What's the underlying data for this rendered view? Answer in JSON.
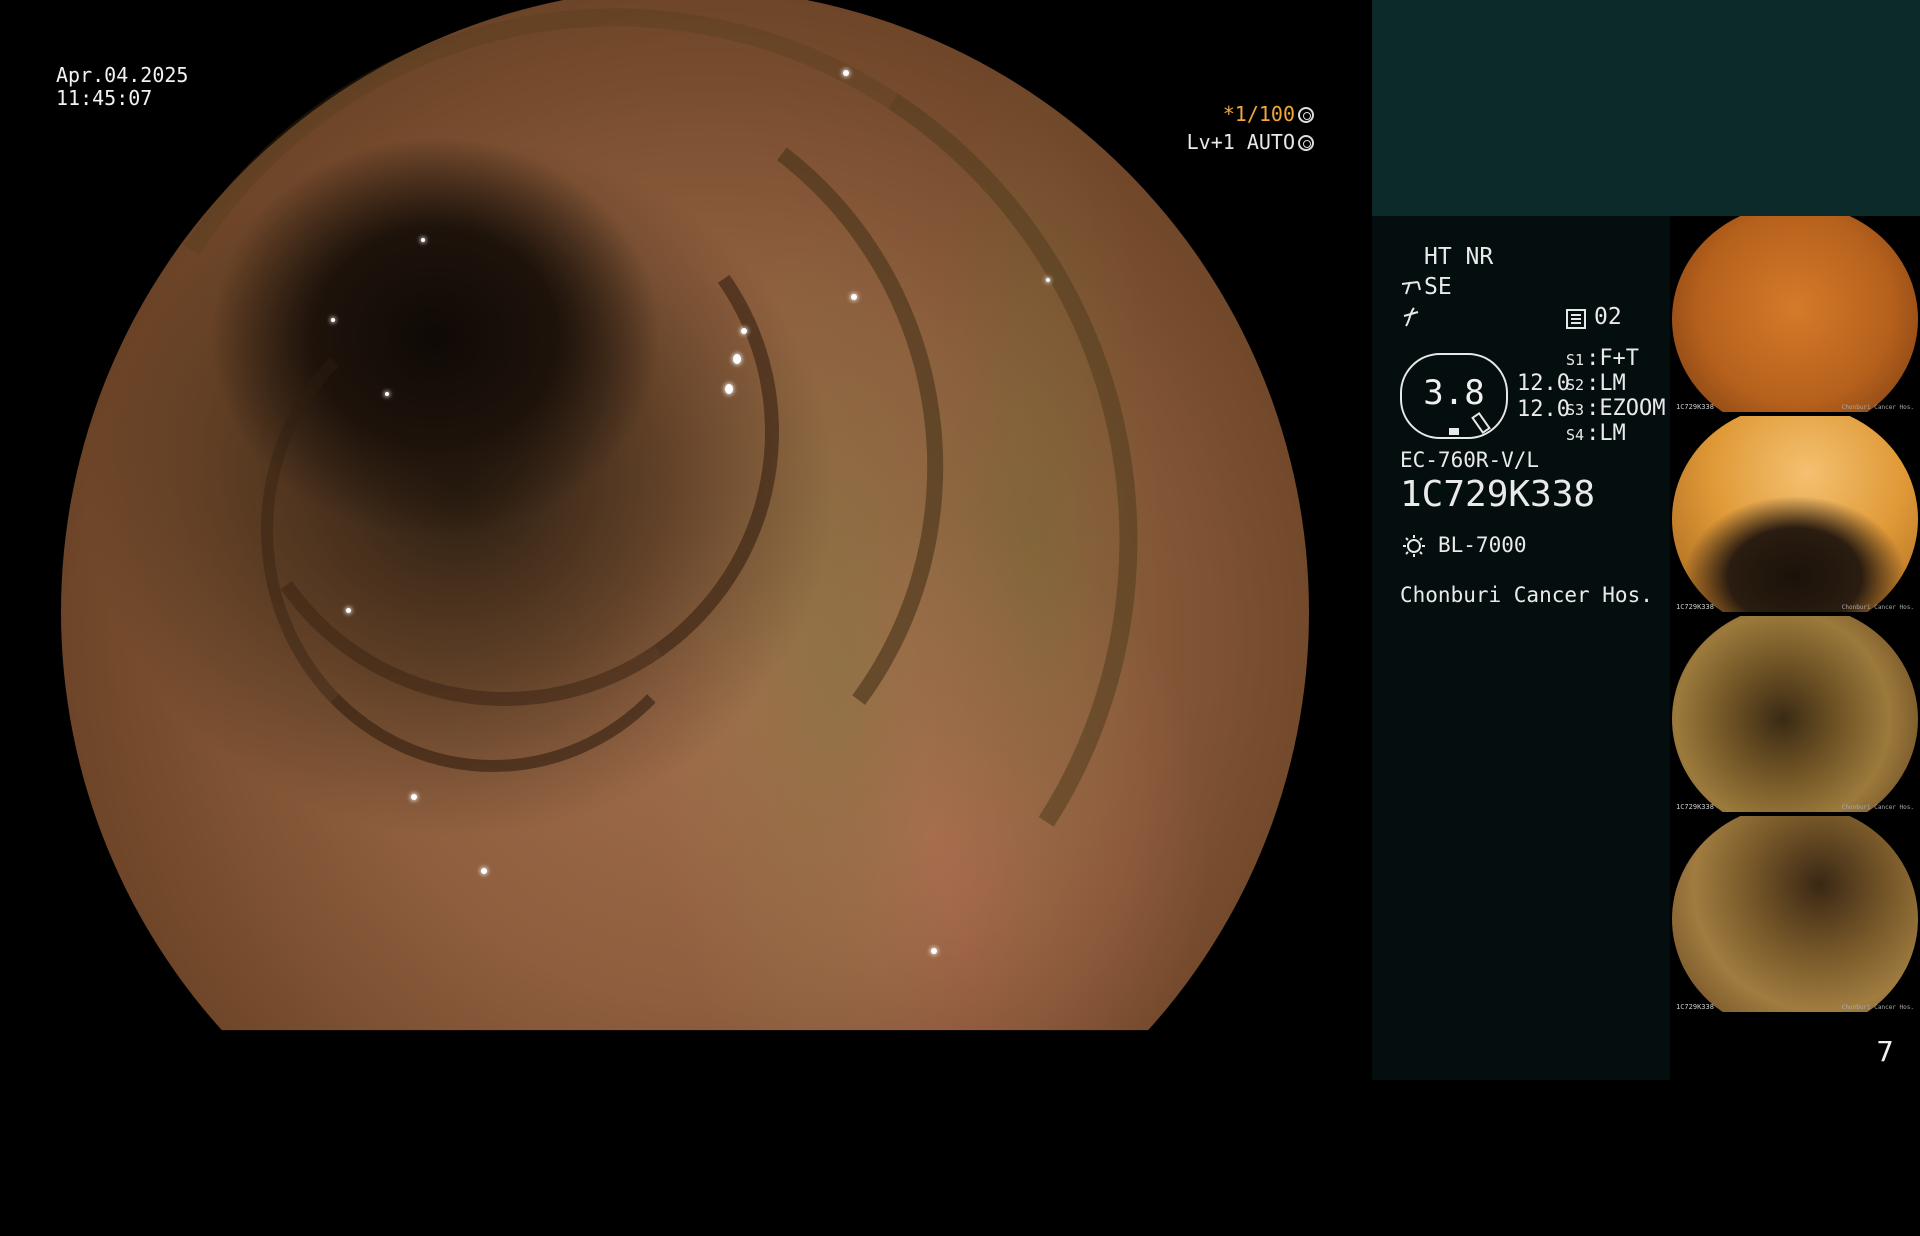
{
  "overlay": {
    "date": "Apr.04.2025",
    "time": "11:45:07",
    "shutter_speed": "*1/100",
    "level": "Lv+1",
    "mode": "AUTO"
  },
  "info": {
    "modes": "HT NR",
    "se_label": "SE",
    "memory_code": "02",
    "gauge_value": "3.8",
    "gauge_readout_1": "12.0",
    "gauge_readout_2": "12.0",
    "switches": [
      {
        "key": "S1",
        "value": "F+T"
      },
      {
        "key": "S2",
        "value": "LM"
      },
      {
        "key": "S3",
        "value": "EZOOM"
      },
      {
        "key": "S4",
        "value": "LM"
      }
    ],
    "scope_model": "EC-760R-V/L",
    "serial": "1C729K338",
    "light_source": "BL-7000",
    "hospital": "Chonburi Cancer Hos."
  },
  "thumbnails": [
    {
      "caption": "1C729K338",
      "caption_right": "Chonburi Cancer Hos."
    },
    {
      "caption": "1C729K338",
      "caption_right": "Chonburi Cancer Hos."
    },
    {
      "caption": "1C729K338",
      "caption_right": "Chonburi Cancer Hos."
    },
    {
      "caption": "1C729K338",
      "caption_right": "Chonburi Cancer Hos."
    }
  ],
  "page_number": "7",
  "colors": {
    "accent": "#f0a838",
    "panel_top": "#0d2a2a",
    "panel_info": "#050e0e"
  },
  "icons": [
    "shutter-icon",
    "auto-icon",
    "scope-icon",
    "memory-icon",
    "light-source-icon"
  ]
}
